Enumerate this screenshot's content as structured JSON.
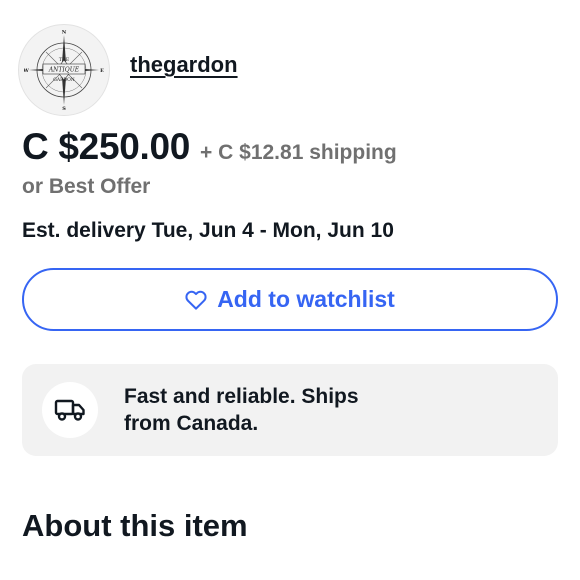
{
  "seller": {
    "logo": {
      "compass_letters": {
        "n": "N",
        "e": "E",
        "s": "S",
        "w": "W"
      },
      "line1": "THE",
      "line2": "ANTIQUE",
      "line3": "GARDON"
    },
    "name": "thegardon"
  },
  "price": {
    "amount": "C $250.00",
    "shipping": "+ C $12.81 shipping",
    "best_offer": "or Best Offer"
  },
  "delivery": "Est. delivery Tue, Jun 4 - Mon, Jun 10",
  "watchlist": {
    "label": "Add to watchlist",
    "icon": "heart-outline-icon",
    "color": "#3665f3"
  },
  "shipping_info": {
    "icon": "truck-icon",
    "text": "Fast and reliable. Ships from Canada."
  },
  "about_heading": "About this item"
}
